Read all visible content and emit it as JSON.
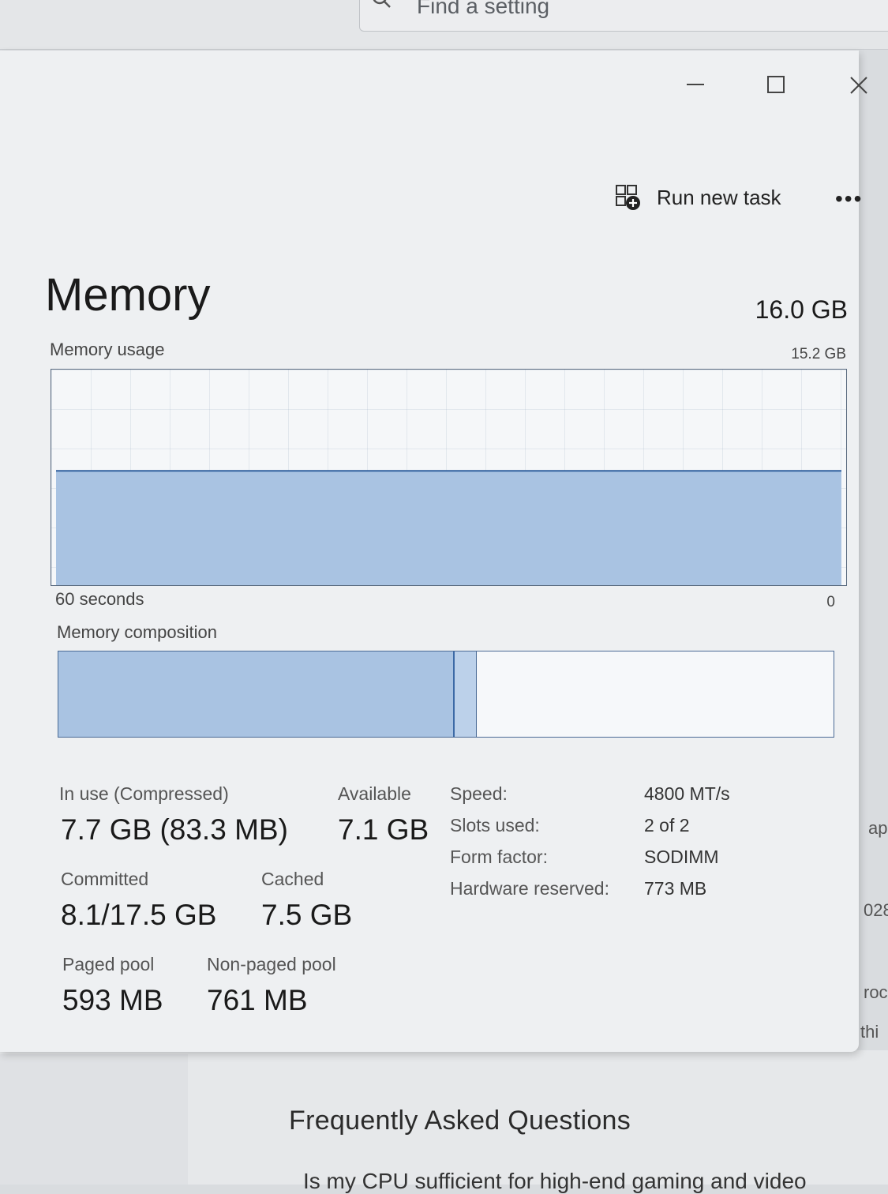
{
  "background": {
    "search_placeholder": "Find a setting",
    "faq_title": "Frequently Asked Questions",
    "faq_first_line": "Is my CPU sufficient for high-end gaming and video",
    "right_fragments": [
      "ap",
      "028",
      "roc",
      "thi"
    ]
  },
  "toolbar": {
    "run_new_task_label": "Run new task",
    "more_label": "•••"
  },
  "memory": {
    "title": "Memory",
    "total": "16.0 GB",
    "usage_label": "Memory usage",
    "usage_max": "15.2 GB",
    "time_span_label": "60 seconds",
    "time_end_label": "0",
    "composition_label": "Memory composition",
    "usage_graph_level": 0.53,
    "composition": {
      "in_use": 0.509,
      "modified": 0.03,
      "standby": 0.461
    },
    "in_use_label": "In use (Compressed)",
    "in_use_value": "7.7 GB (83.3 MB)",
    "available_label": "Available",
    "available_value": "7.1 GB",
    "committed_label": "Committed",
    "committed_value": "8.1/17.5 GB",
    "cached_label": "Cached",
    "cached_value": "7.5 GB",
    "paged_pool_label": "Paged pool",
    "paged_pool_value": "593 MB",
    "non_paged_pool_label": "Non-paged pool",
    "non_paged_pool_value": "761 MB",
    "details": {
      "speed_label": "Speed:",
      "speed_value": "4800 MT/s",
      "slots_label": "Slots used:",
      "slots_value": "2 of 2",
      "form_factor_label": "Form factor:",
      "form_factor_value": "SODIMM",
      "hw_reserved_label": "Hardware reserved:",
      "hw_reserved_value": "773 MB"
    }
  },
  "colors": {
    "graph_fill": "#a9c3e2",
    "graph_line": "#2f5f9e",
    "window_bg": "#eef0f2"
  }
}
